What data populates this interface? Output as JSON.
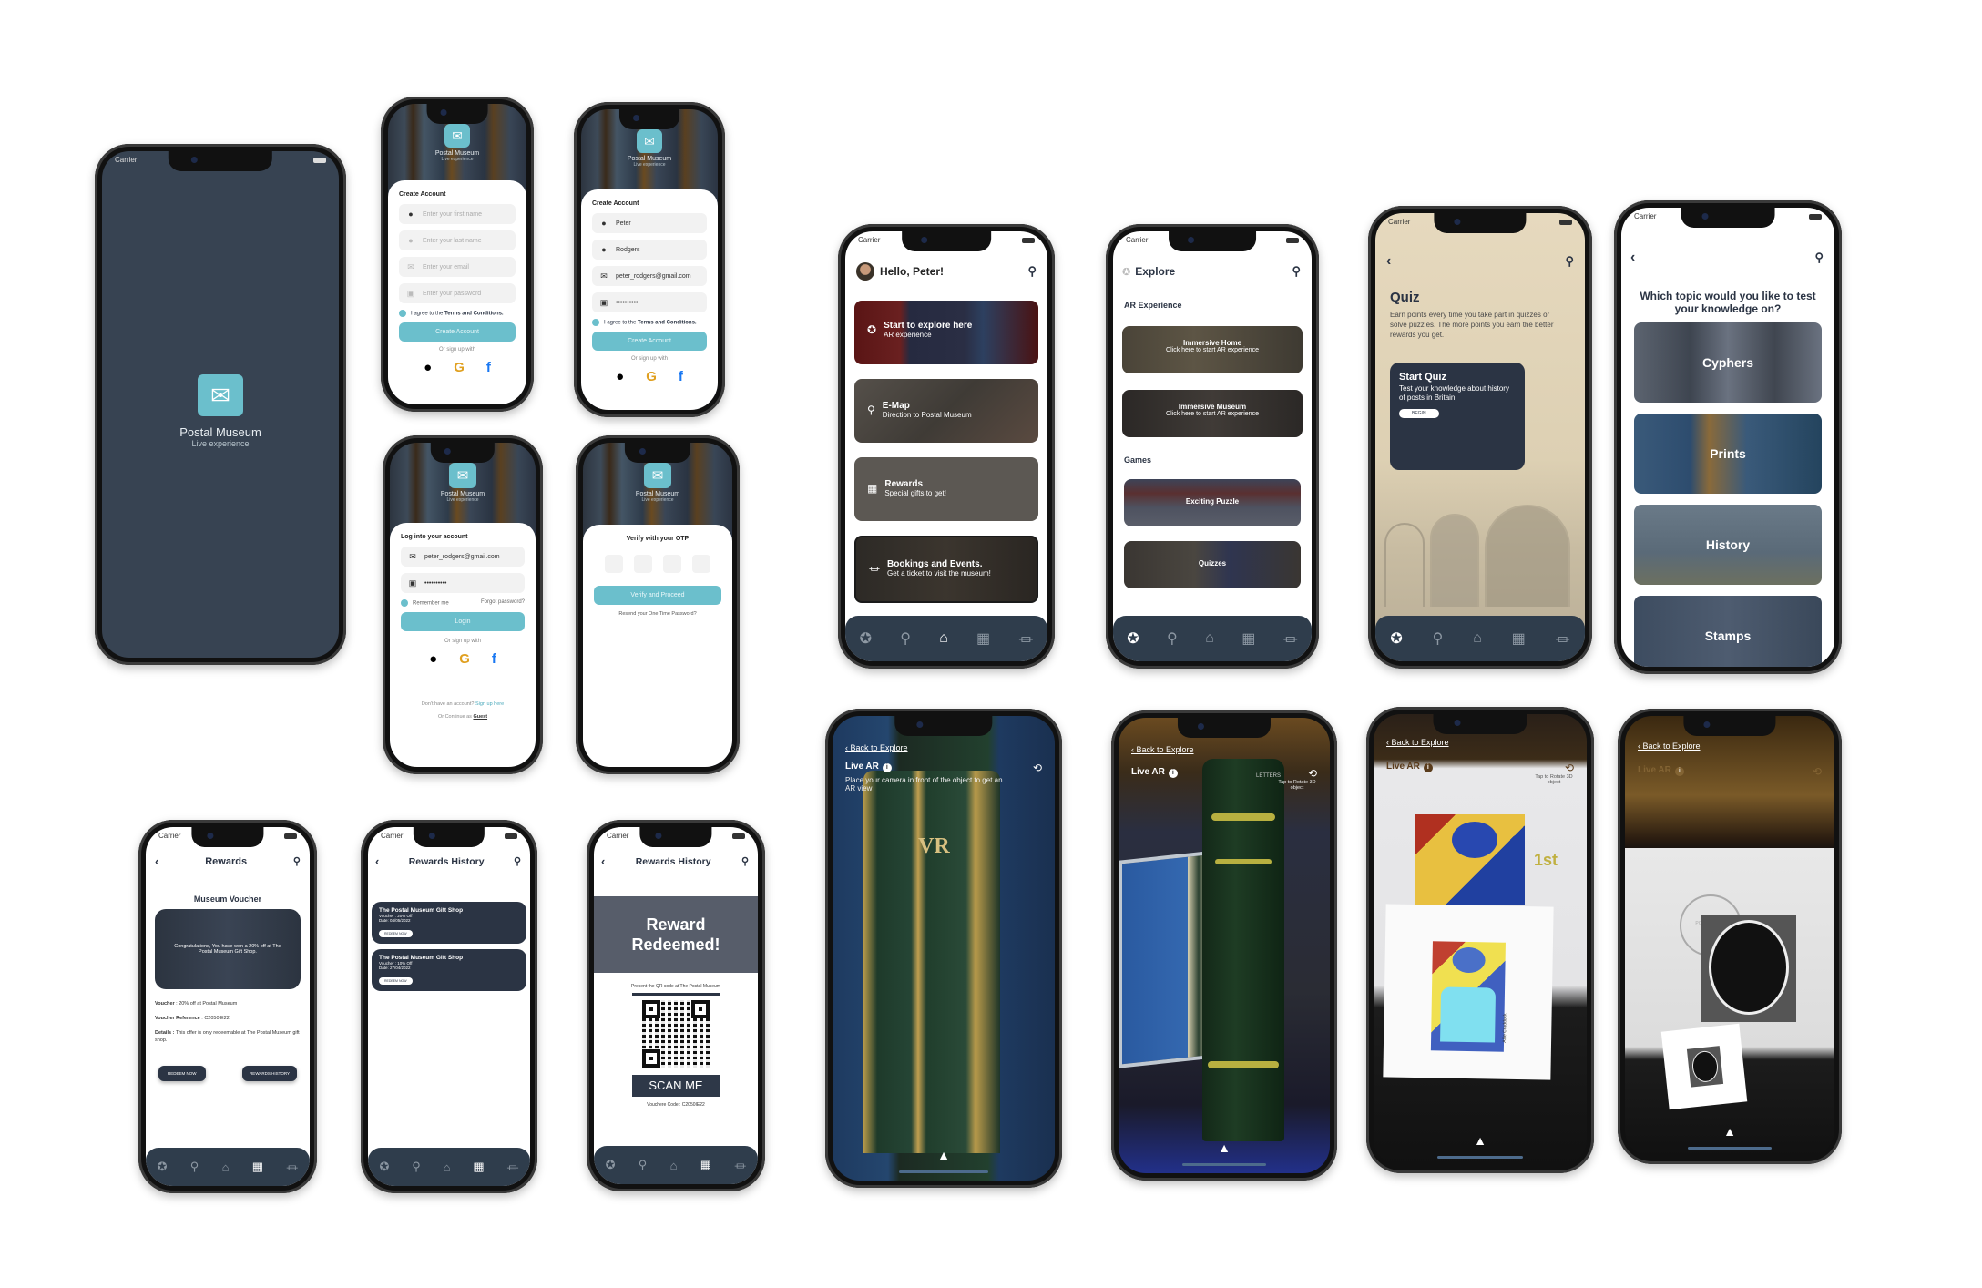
{
  "app": {
    "name": "Postal Museum",
    "tagline": "Live experience",
    "carrier": "Carrier",
    "colors": {
      "primary_dark": "#2f3d4c",
      "accent_teal": "#6bbfcc",
      "card_dark": "#2b3444"
    }
  },
  "splash": {
    "title": "Postal Museum",
    "subtitle": "Live experience"
  },
  "create_account_empty": {
    "heading": "Create Account",
    "fields": [
      {
        "icon": "user-icon",
        "placeholder": "Enter your first name"
      },
      {
        "icon": "user-icon",
        "placeholder": "Enter your last name"
      },
      {
        "icon": "mail-icon",
        "placeholder": "Enter your email"
      },
      {
        "icon": "lock-icon",
        "placeholder": "Enter your password"
      }
    ],
    "agree_prefix": "I agree to the ",
    "agree_link": "Terms and Conditions.",
    "button": "Create Account",
    "or_sign_up": "Or sign up with"
  },
  "create_account_filled": {
    "heading": "Create Account",
    "fields": [
      {
        "icon": "user-icon",
        "value": "Peter"
      },
      {
        "icon": "user-icon",
        "value": "Rodgers"
      },
      {
        "icon": "mail-icon",
        "value": "peter_rodgers@gmail.com"
      },
      {
        "icon": "lock-icon",
        "value": "••••••••••"
      }
    ],
    "agree_prefix": "I agree to the ",
    "agree_link": "Terms and Conditions.",
    "button": "Create Account",
    "or_sign_up": "Or sign up with"
  },
  "login": {
    "heading": "Log into your account",
    "email": "peter_rodgers@gmail.com",
    "password": "••••••••••",
    "remember": "Remember me",
    "forgot": "Forgot password?",
    "button": "Login",
    "or_sign_up": "Or sign up with",
    "no_account": "Don't have an account? ",
    "sign_up_link": "Sign up here",
    "guest_prefix": "Or Continue as ",
    "guest_link": "Guest"
  },
  "otp": {
    "heading": "Verify with your OTP",
    "button": "Verify and Proceed",
    "resend": "Resend your One Time Password?"
  },
  "home": {
    "greeting": "Hello, Peter!",
    "cards": [
      {
        "icon": "compass-icon",
        "title": "Start to explore here",
        "subtitle": "AR experience"
      },
      {
        "icon": "map-pin-icon",
        "title": "E-Map",
        "subtitle": "Direction to Postal Museum"
      },
      {
        "icon": "gift-icon",
        "title": "Rewards",
        "subtitle": "Special gifts to get!"
      },
      {
        "icon": "museum-icon",
        "title": "Bookings and Events.",
        "subtitle": "Get a ticket to visit the museum!"
      }
    ]
  },
  "explore": {
    "title": "Explore",
    "ar_section": "AR Experience",
    "ar_cards": [
      {
        "title": "Immersive Home",
        "subtitle": "Click here to start AR experience"
      },
      {
        "title": "Immersive Museum",
        "subtitle": "Click here to start AR experience"
      }
    ],
    "games_section": "Games",
    "games_cards": [
      {
        "title": "Exciting Puzzle"
      },
      {
        "title": "Quizzes"
      }
    ]
  },
  "quiz": {
    "title": "Quiz",
    "description": "Earn points every time you take part in quizzes or solve puzzles. The more points you earn the better rewards you get.",
    "card_title": "Start Quiz",
    "card_text": "Test your knowledge about history of posts in Britain.",
    "begin": "BEGIN"
  },
  "topics": {
    "question": "Which topic would you like to test your knowledge on?",
    "items": [
      "Cyphers",
      "Prints",
      "History",
      "Stamps"
    ]
  },
  "rewards": {
    "title": "Rewards",
    "voucher_heading": "Museum Voucher",
    "banner_text": "Congratulations, You have won a 20% off at The Postal Museum Gift Shop.",
    "voucher_label": "Voucher",
    "voucher_value": " : 20% off at Postal Museum",
    "reference_label": "Voucher Reference",
    "reference_value": " : C2050IE22",
    "details_label": "Details :",
    "details_value": " This offer is only redeemable at The Postal Museum gift shop.",
    "redeem_button": "REDEEM NOW",
    "history_button": "REWARDS HISTORY"
  },
  "rewards_history": {
    "title": "Rewards History",
    "items": [
      {
        "shop": "The Postal Museum Gift Shop",
        "voucher": "Voucher : 20% Off",
        "date": "Date: 04/05/2022",
        "button": "REDEEM NOW"
      },
      {
        "shop": "The Postal Museum Gift Shop",
        "voucher": "Voucher : 10% Off",
        "date": "Date: 27/04/2022",
        "button": "REDEEM NOW"
      }
    ]
  },
  "redeemed": {
    "title": "Rewards History",
    "banner": "Reward Redeemed!",
    "instruction": "Present the QR code at The Postal Museum",
    "scan_label": "SCAN ME",
    "voucher_code": "Vouchere Code : C2050IE22"
  },
  "ar_screens": [
    {
      "back": "Back to Explore",
      "title": "Live AR",
      "hint": "Place your camera in front of the object to get an AR view",
      "scene": "VR pillar box"
    },
    {
      "back": "Back to Explore",
      "title": "Live AR",
      "hint": "Tap to Rotate 3D object",
      "scene": "3D letters pillar box",
      "object_label": "LETTERS"
    },
    {
      "back": "Back to Explore",
      "title": "Live AR",
      "hint": "Tap to Rotate 3D object",
      "scene": "Nurse stamp",
      "stamp_value": "1st",
      "stamp_caption": "Allie Craddock"
    },
    {
      "back": "Back to Explore",
      "title": "Live AR",
      "hint": "",
      "scene": "Queen portrait stamp",
      "postmark": "POST OFFICE"
    }
  ],
  "nav": {
    "items": [
      {
        "icon": "compass-icon",
        "glyph": "✪"
      },
      {
        "icon": "map-pin-icon",
        "glyph": "⚲"
      },
      {
        "icon": "home-icon",
        "glyph": "⌂"
      },
      {
        "icon": "gift-icon",
        "glyph": "▦"
      },
      {
        "icon": "museum-icon",
        "glyph": "⏛"
      }
    ]
  },
  "icons": {
    "search": "⚲",
    "back": "‹",
    "apple": "",
    "google": "G",
    "facebook": "f",
    "mail": "✉",
    "up": "▲",
    "rotate": "⟲"
  }
}
